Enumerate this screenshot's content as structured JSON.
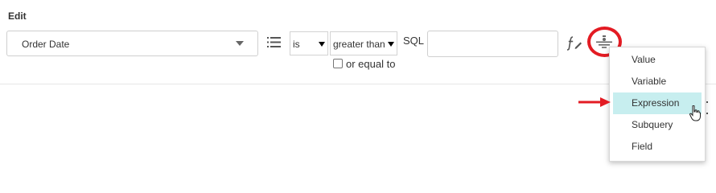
{
  "section": {
    "title": "Edit"
  },
  "field_select": {
    "value": "Order Date"
  },
  "is_select": {
    "value": "is"
  },
  "operator_select": {
    "value": "greater than"
  },
  "or_equal": {
    "label": "or equal to",
    "checked": false
  },
  "sql": {
    "label": "SQL",
    "value": ""
  },
  "icons": {
    "list": "list-icon",
    "function": "function-icon",
    "type_menu": "filter-type-icon",
    "cursor": "cursor-icon",
    "arrow": "red-arrow"
  },
  "dropdown": {
    "items": [
      {
        "label": "Value"
      },
      {
        "label": "Variable"
      },
      {
        "label": "Expression"
      },
      {
        "label": "Subquery"
      },
      {
        "label": "Field"
      }
    ],
    "active_item": "Expression"
  },
  "colors": {
    "highlight_ring": "#e31b23",
    "arrow": "#e31b23",
    "active_item_bg": "#c7eeef"
  }
}
